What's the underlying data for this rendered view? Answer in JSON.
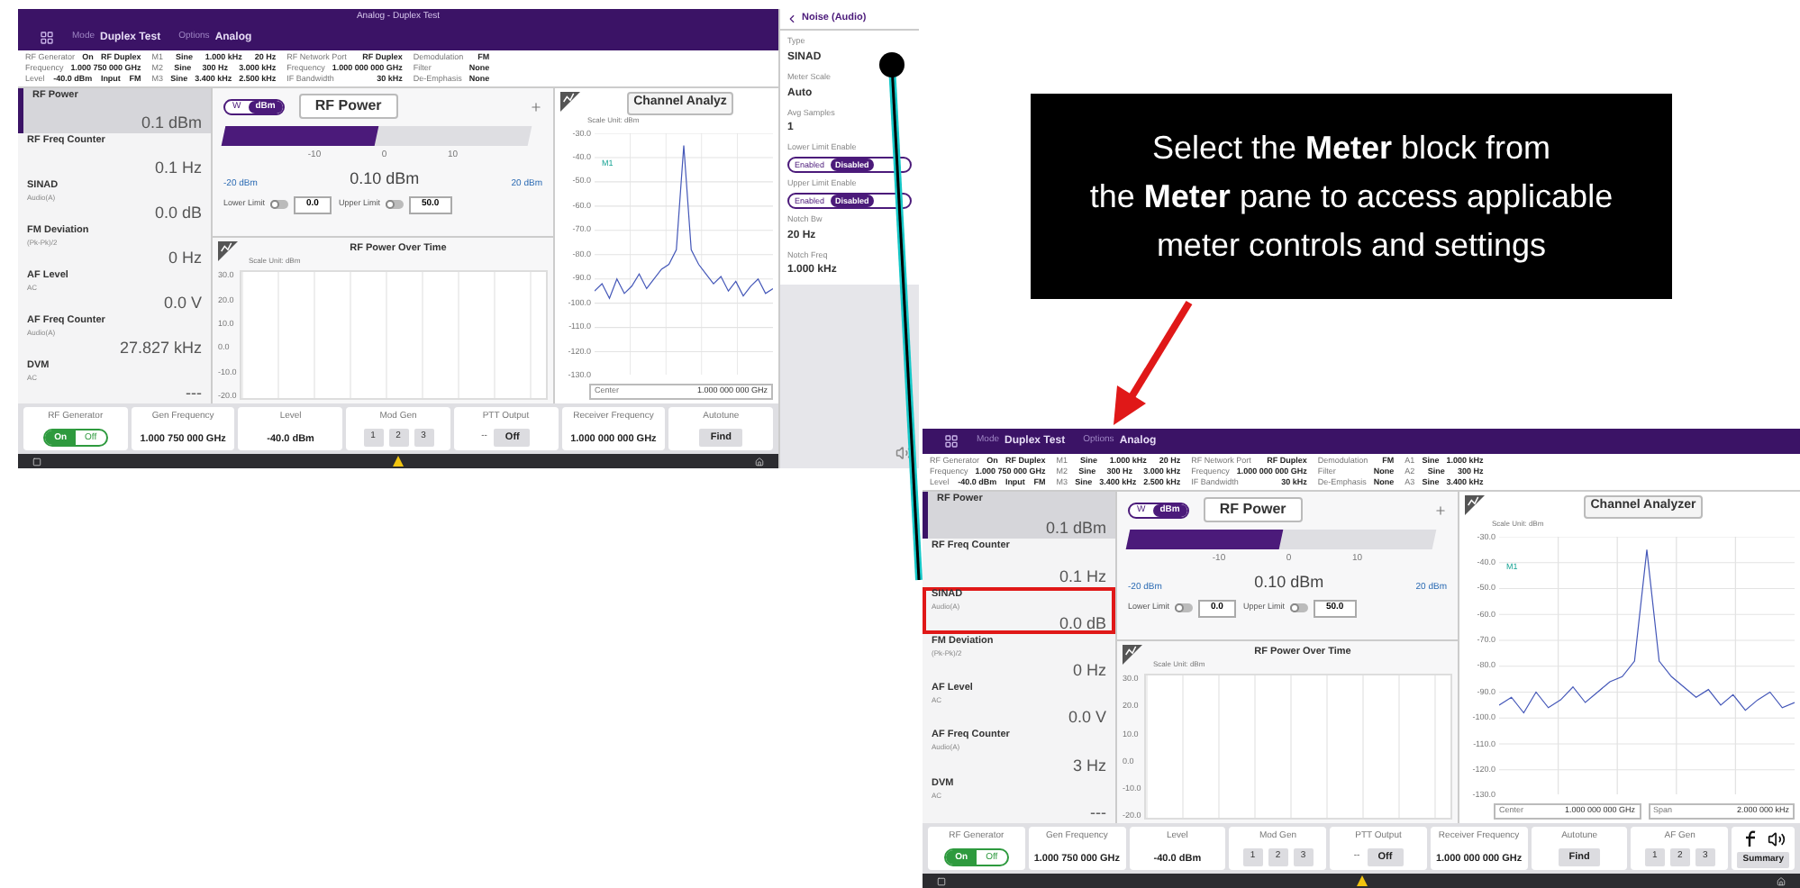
{
  "callout": {
    "text": "Select the **Meter** block from\nthe **Meter** pane to access applicable\nmeter controls and settings"
  },
  "screens": [
    {
      "title": "Analog - Duplex Test",
      "mode_label": "Mode",
      "mode": "Duplex Test",
      "options_label": "Options",
      "options": "Analog",
      "info": [
        [
          [
            "RF Generator",
            "On",
            "RF Duplex"
          ],
          [
            "Frequency",
            "1.000 750 000 GHz"
          ],
          [
            "Level",
            "-40.0 dBm",
            "Input",
            "FM"
          ]
        ],
        [
          [
            "M1",
            "Sine",
            "1.000 kHz",
            "20 Hz"
          ],
          [
            "M2",
            "Sine",
            "300 Hz",
            "3.000 kHz"
          ],
          [
            "M3",
            "Sine",
            "3.400 kHz",
            "2.500 kHz"
          ]
        ],
        [
          [
            "RF Network Port",
            "RF Duplex"
          ],
          [
            "Frequency",
            "1.000 000 000 GHz"
          ],
          [
            "IF Bandwidth",
            "30 kHz"
          ]
        ],
        [
          [
            "Demodulation",
            "FM"
          ],
          [
            "Filter",
            "None"
          ],
          [
            "De-Emphasis",
            "None"
          ]
        ]
      ],
      "meters": [
        {
          "label": "RF Power",
          "value": "0.1 dBm",
          "selected": true,
          "highlighted": false
        },
        {
          "label": "RF Freq Counter",
          "value": "0.1 Hz",
          "selected": false,
          "highlighted": false
        },
        {
          "label": "SINAD",
          "sub": "Audio(A)",
          "value": "0.0 dB",
          "selected": false,
          "highlighted": false
        },
        {
          "label": "FM Deviation",
          "sub": "(Pk-Pk)/2",
          "value": "0 Hz",
          "selected": false,
          "highlighted": false
        },
        {
          "label": "AF Level",
          "sub": "AC",
          "value": "0.0 V",
          "selected": false,
          "highlighted": false
        },
        {
          "label": "AF Freq Counter",
          "sub": "Audio(A)",
          "value": "27.827 kHz",
          "selected": false,
          "highlighted": false
        },
        {
          "label": "DVM",
          "sub": "AC",
          "value": "---",
          "selected": false,
          "highlighted": false
        }
      ],
      "rf_power": {
        "units": [
          {
            "label": "W",
            "selected": false
          },
          {
            "label": "dBm",
            "selected": true
          }
        ],
        "title": "RF Power",
        "level": 0.5,
        "scale": [
          "-10",
          "0",
          "10"
        ],
        "min": "-20 dBm",
        "reading": "0.10 dBm",
        "max": "20 dBm",
        "limits": [
          {
            "label": "Lower Limit",
            "on": false,
            "value": "0.0"
          },
          {
            "label": "Upper Limit",
            "on": false,
            "value": "50.0"
          }
        ]
      },
      "over_time": {
        "title": "RF Power Over Time",
        "scale_unit": "Scale Unit: dBm",
        "yticks": [
          "30.0",
          "20.0",
          "10.0",
          "0.0",
          "-10.0",
          "-20.0"
        ]
      },
      "analyzer": {
        "title": "Channel Analyz",
        "scale_unit": "Scale Unit: dBm",
        "marker": "M1",
        "center_label": "Center",
        "center": "1.000 000 000 GHz",
        "chart_data": {
          "type": "line",
          "grid": true,
          "ylim": [
            -130,
            -30
          ],
          "yticks": [
            {
              "value": -30,
              "label": "-30.0"
            },
            {
              "value": -40,
              "label": "-40.0"
            },
            {
              "value": -50,
              "label": "-50.0"
            },
            {
              "value": -60,
              "label": "-60.0"
            },
            {
              "value": -70,
              "label": "-70.0"
            },
            {
              "value": -80,
              "label": "-80.0"
            },
            {
              "value": -90,
              "label": "-90.0"
            },
            {
              "value": -100,
              "label": "-100.0"
            },
            {
              "value": -110,
              "label": "-110.0"
            },
            {
              "value": -120,
              "label": "-120.0"
            },
            {
              "value": -130,
              "label": "-130.0"
            }
          ],
          "series": [
            {
              "color": "#4457b8",
              "values": [
                -95,
                -92,
                -98,
                -90,
                -96,
                -93,
                -88,
                -94,
                -90,
                -86,
                -84,
                -78,
                -35,
                -78,
                -84,
                -88,
                -92,
                -89,
                -95,
                -91,
                -97,
                -93,
                -90,
                -96,
                -94
              ]
            }
          ]
        }
      },
      "bottom": [
        {
          "kind": "toggle",
          "label": "RF Generator",
          "options": [
            {
              "label": "On",
              "selected": true
            },
            {
              "label": "Off",
              "selected": false
            }
          ]
        },
        {
          "kind": "value",
          "label": "Gen Frequency",
          "value": "1.000 750 000 GHz"
        },
        {
          "kind": "value",
          "label": "Level",
          "value": "-40.0 dBm"
        },
        {
          "kind": "keys",
          "label": "Mod Gen",
          "keys": [
            "1",
            "2",
            "3"
          ]
        },
        {
          "kind": "button",
          "label": "PTT Output",
          "prefix": "--",
          "value": "Off"
        },
        {
          "kind": "value",
          "label": "Receiver Frequency",
          "value": "1.000 000 000 GHz"
        },
        {
          "kind": "button",
          "label": "Autotune",
          "value": "Find"
        }
      ],
      "panel": {
        "title": "Noise (Audio)",
        "fields": [
          {
            "kind": "value",
            "label": "Type",
            "value": "SINAD"
          },
          {
            "kind": "value",
            "label": "Meter Scale",
            "value": "Auto"
          },
          {
            "kind": "value",
            "label": "Avg Samples",
            "value": "1"
          },
          {
            "kind": "toggle",
            "label": "Lower Limit Enable",
            "options": [
              {
                "label": "Enabled",
                "selected": false
              },
              {
                "label": "Disabled",
                "selected": true
              }
            ]
          },
          {
            "kind": "toggle",
            "label": "Upper Limit Enable",
            "options": [
              {
                "label": "Enabled",
                "selected": false
              },
              {
                "label": "Disabled",
                "selected": true
              }
            ]
          },
          {
            "kind": "value",
            "label": "Notch Bw",
            "value": "20 Hz"
          },
          {
            "kind": "value",
            "label": "Notch Freq",
            "value": "1.000 kHz"
          }
        ]
      }
    },
    {
      "mode_label": "Mode",
      "mode": "Duplex Test",
      "options_label": "Options",
      "options": "Analog",
      "info": [
        [
          [
            "RF Generator",
            "On",
            "RF Duplex"
          ],
          [
            "Frequency",
            "1.000 750 000 GHz"
          ],
          [
            "Level",
            "-40.0 dBm",
            "Input",
            "FM"
          ]
        ],
        [
          [
            "M1",
            "Sine",
            "1.000 kHz",
            "20 Hz"
          ],
          [
            "M2",
            "Sine",
            "300 Hz",
            "3.000 kHz"
          ],
          [
            "M3",
            "Sine",
            "3.400 kHz",
            "2.500 kHz"
          ]
        ],
        [
          [
            "RF Network Port",
            "RF Duplex"
          ],
          [
            "Frequency",
            "1.000 000 000 GHz"
          ],
          [
            "IF Bandwidth",
            "30 kHz"
          ]
        ],
        [
          [
            "Demodulation",
            "FM"
          ],
          [
            "Filter",
            "None"
          ],
          [
            "De-Emphasis",
            "None"
          ]
        ],
        [
          [
            "A1",
            "Sine",
            "1.000 kHz"
          ],
          [
            "A2",
            "Sine",
            "300 Hz"
          ],
          [
            "A3",
            "Sine",
            "3.400 kHz"
          ]
        ]
      ],
      "meters": [
        {
          "label": "RF Power",
          "value": "0.1 dBm",
          "selected": true,
          "highlighted": false
        },
        {
          "label": "RF Freq Counter",
          "value": "0.1 Hz",
          "selected": false,
          "highlighted": false
        },
        {
          "label": "SINAD",
          "sub": "Audio(A)",
          "value": "0.0 dB",
          "selected": false,
          "highlighted": true
        },
        {
          "label": "FM Deviation",
          "sub": "(Pk-Pk)/2",
          "value": "0 Hz",
          "selected": false,
          "highlighted": false
        },
        {
          "label": "AF Level",
          "sub": "AC",
          "value": "0.0 V",
          "selected": false,
          "highlighted": false
        },
        {
          "label": "AF Freq Counter",
          "sub": "Audio(A)",
          "value": "3 Hz",
          "selected": false,
          "highlighted": false
        },
        {
          "label": "DVM",
          "sub": "AC",
          "value": "---",
          "selected": false,
          "highlighted": false
        }
      ],
      "rf_power": {
        "units": [
          {
            "label": "W",
            "selected": false
          },
          {
            "label": "dBm",
            "selected": true
          }
        ],
        "title": "RF Power",
        "level": 0.5,
        "scale": [
          "-10",
          "0",
          "10"
        ],
        "min": "-20 dBm",
        "reading": "0.10 dBm",
        "max": "20 dBm",
        "limits": [
          {
            "label": "Lower Limit",
            "on": false,
            "value": "0.0"
          },
          {
            "label": "Upper Limit",
            "on": false,
            "value": "50.0"
          }
        ]
      },
      "over_time": {
        "title": "RF Power Over Time",
        "scale_unit": "Scale Unit: dBm",
        "yticks": [
          "30.0",
          "20.0",
          "10.0",
          "0.0",
          "-10.0",
          "-20.0"
        ]
      },
      "analyzer": {
        "title": "Channel Analyzer",
        "scale_unit": "Scale Unit: dBm",
        "marker": "M1",
        "center_label": "Center",
        "center": "1.000 000 000 GHz",
        "span_label": "Span",
        "span": "2.000 000 kHz",
        "chart_data": {
          "type": "line",
          "grid": true,
          "ylim": [
            -130,
            -30
          ],
          "yticks": [
            {
              "value": -30,
              "label": "-30.0"
            },
            {
              "value": -40,
              "label": "-40.0"
            },
            {
              "value": -50,
              "label": "-50.0"
            },
            {
              "value": -60,
              "label": "-60.0"
            },
            {
              "value": -70,
              "label": "-70.0"
            },
            {
              "value": -80,
              "label": "-80.0"
            },
            {
              "value": -90,
              "label": "-90.0"
            },
            {
              "value": -100,
              "label": "-100.0"
            },
            {
              "value": -110,
              "label": "-110.0"
            },
            {
              "value": -120,
              "label": "-120.0"
            },
            {
              "value": -130,
              "label": "-130.0"
            }
          ],
          "series": [
            {
              "color": "#4457b8",
              "values": [
                -95,
                -92,
                -98,
                -90,
                -96,
                -93,
                -88,
                -94,
                -90,
                -86,
                -84,
                -78,
                -35,
                -78,
                -84,
                -88,
                -92,
                -89,
                -95,
                -91,
                -97,
                -93,
                -90,
                -96,
                -94
              ]
            }
          ]
        }
      },
      "bottom": [
        {
          "kind": "toggle",
          "label": "RF Generator",
          "options": [
            {
              "label": "On",
              "selected": true
            },
            {
              "label": "Off",
              "selected": false
            }
          ]
        },
        {
          "kind": "value",
          "label": "Gen Frequency",
          "value": "1.000 750 000 GHz"
        },
        {
          "kind": "value",
          "label": "Level",
          "value": "-40.0 dBm"
        },
        {
          "kind": "keys",
          "label": "Mod Gen",
          "keys": [
            "1",
            "2",
            "3"
          ]
        },
        {
          "kind": "button",
          "label": "PTT Output",
          "prefix": "--",
          "value": "Off"
        },
        {
          "kind": "value",
          "label": "Receiver Frequency",
          "value": "1.000 000 000 GHz"
        },
        {
          "kind": "button",
          "label": "Autotune",
          "value": "Find"
        },
        {
          "kind": "keys",
          "label": "AF Gen",
          "keys": [
            "1",
            "2",
            "3"
          ]
        },
        {
          "kind": "tools",
          "value": "Summary"
        }
      ]
    }
  ]
}
